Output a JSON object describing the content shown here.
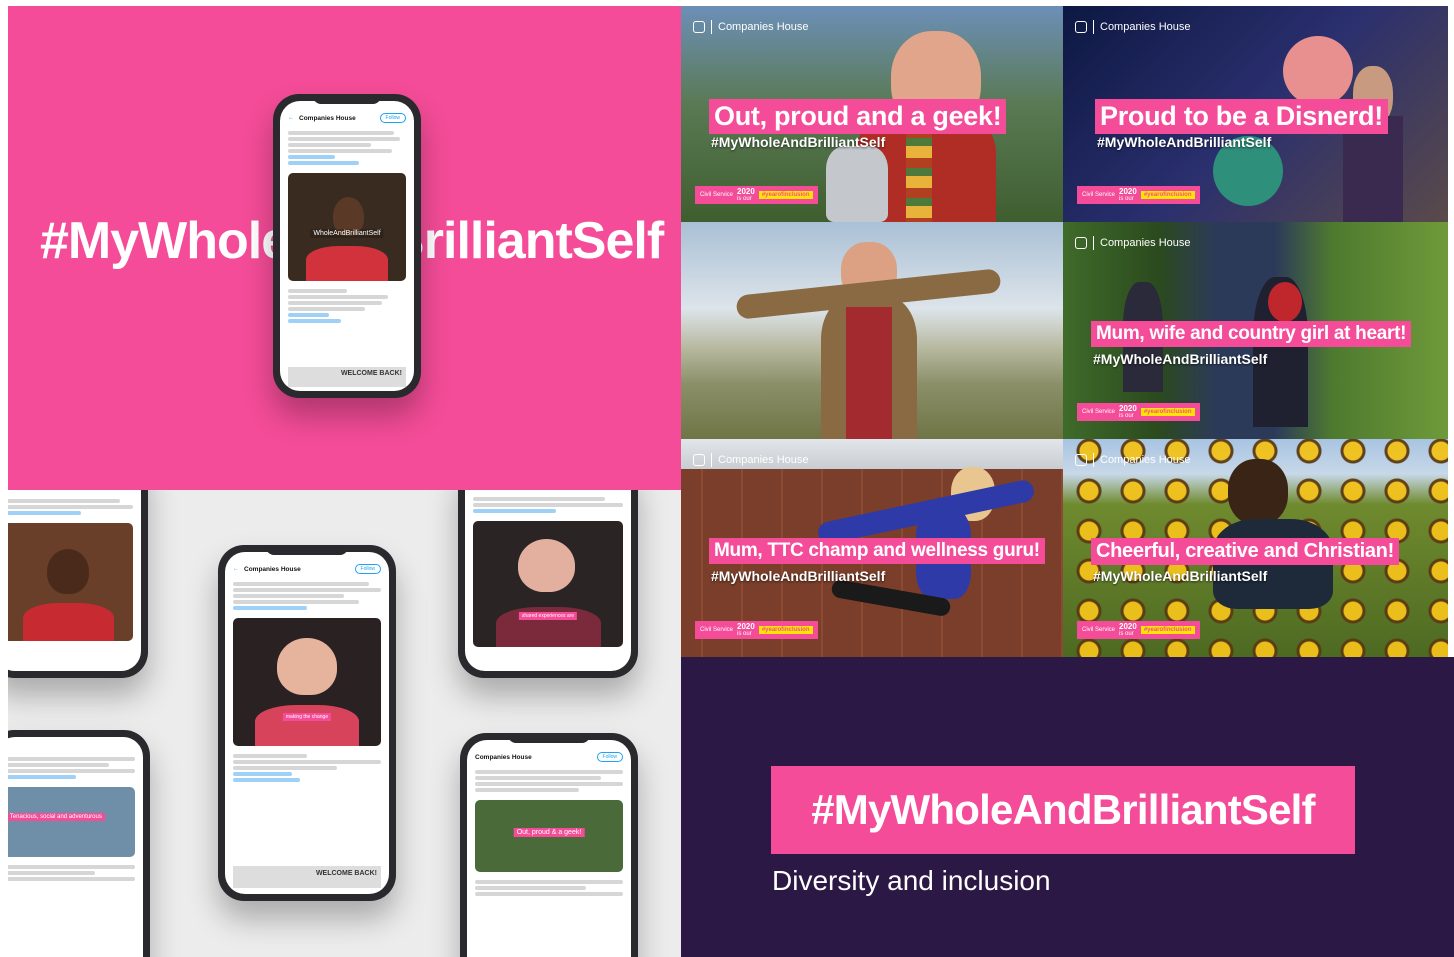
{
  "hero": {
    "hashtag": "#MyWholeAndBrilliantSelf"
  },
  "brand": {
    "name": "Companies House",
    "pink": "#f44c98",
    "purple": "#2b1844",
    "yellow": "#ffe600"
  },
  "tweet": {
    "account": "Companies House",
    "follow_label": "Follow",
    "overlay": "WholeAndBrilliantSelf"
  },
  "tiles": [
    {
      "title": "Out, proud and a geek!",
      "hashtag": "#MyWholeAndBrilliantSelf"
    },
    {
      "title": "Proud to be a Disnerd!",
      "hashtag": "#MyWholeAndBrilliantSelf"
    },
    {
      "title": "",
      "hashtag": ""
    },
    {
      "title": "Mum, wife and country girl at heart!",
      "hashtag": "#MyWholeAndBrilliantSelf"
    },
    {
      "title": "Mum, TTC champ and wellness guru!",
      "hashtag": "#MyWholeAndBrilliantSelf"
    },
    {
      "title": "Cheerful, creative and Christian!",
      "hashtag": "#MyWholeAndBrilliantSelf"
    }
  ],
  "badge": {
    "service": "Civil Service",
    "year": "2020",
    "is_our": "is our",
    "tag": "#yearofinclusion"
  },
  "mock_captions": {
    "making": "making the change",
    "shared": "shared experiences are",
    "adventurous": "Tenacious, social and adventurous",
    "proud": "Out, proud & a geek!",
    "welcome": "WELCOME BACK!"
  },
  "footer": {
    "hashtag": "#MyWholeAndBrilliantSelf",
    "subtitle": "Diversity and inclusion"
  }
}
